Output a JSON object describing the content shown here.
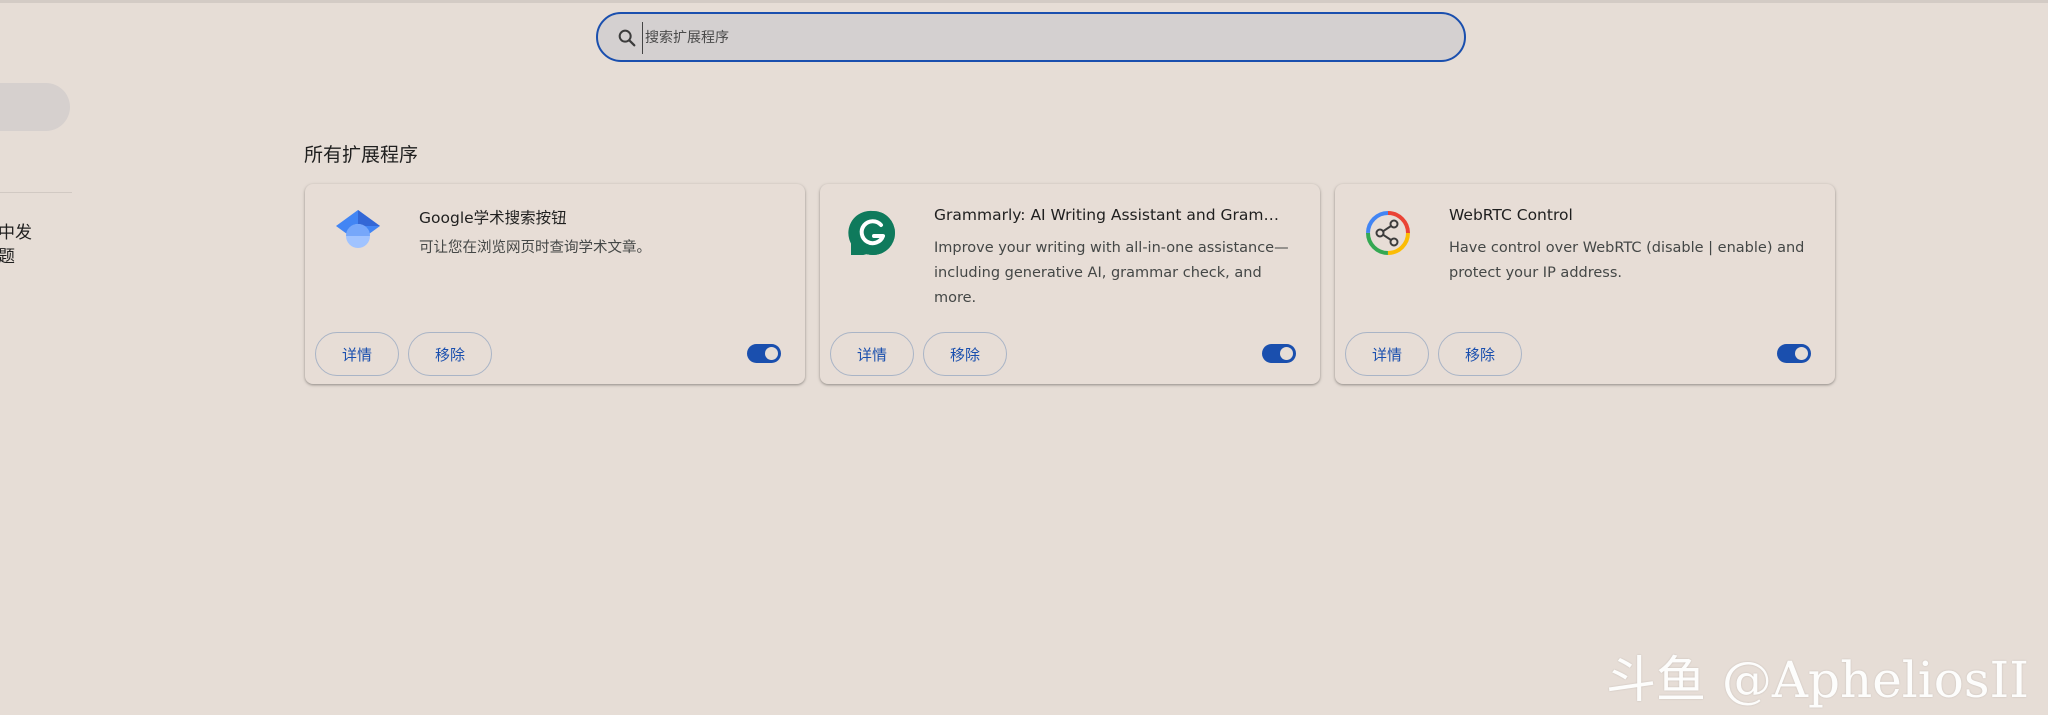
{
  "search": {
    "placeholder": "搜索扩展程序",
    "value": ""
  },
  "sidebar": {
    "partial_texts": [
      "中发",
      "题"
    ]
  },
  "section": {
    "title": "所有扩展程序"
  },
  "extensions": [
    {
      "name": "Google学术搜索按钮",
      "description": "可让您在浏览网页时查询学术文章。",
      "icon": "google-scholar-icon",
      "enabled": true,
      "details_label": "详情",
      "remove_label": "移除"
    },
    {
      "name": "Grammarly: AI Writing Assistant and Grammar Checker App",
      "description": "Improve your writing with all-in-one assistance—including generative AI, grammar check, and more.",
      "icon": "grammarly-icon",
      "enabled": true,
      "details_label": "详情",
      "remove_label": "移除"
    },
    {
      "name": "WebRTC Control",
      "description": "Have control over WebRTC (disable | enable) and protect your IP address.",
      "icon": "webrtc-share-icon",
      "enabled": true,
      "details_label": "详情",
      "remove_label": "移除"
    }
  ],
  "watermark": {
    "text": "斗鱼 @ApheliosII"
  },
  "colors": {
    "accent": "#1a4fae",
    "background": "#e6ddd6",
    "grammarly_green": "#0f7a5c"
  }
}
